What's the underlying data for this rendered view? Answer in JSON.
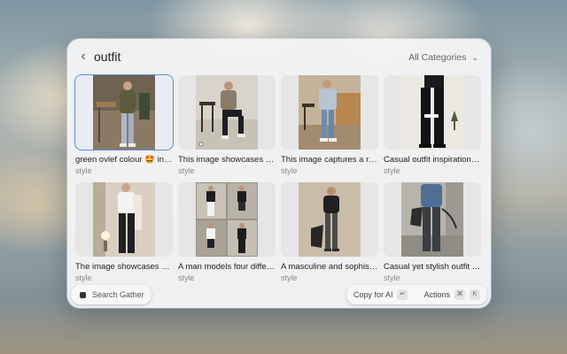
{
  "search": {
    "query": "outfit",
    "category": "All Categories"
  },
  "icons": {
    "back": "chevron-left-icon",
    "category": "chevron-down-icon",
    "gather": "gather-logo-icon"
  },
  "results": [
    {
      "title": "green ovlef colour 🤩 in 2...",
      "tag": "style",
      "selected": true
    },
    {
      "title": "This image showcases a r...",
      "tag": "style",
      "selected": false
    },
    {
      "title": "This image captures a rel...",
      "tag": "style",
      "selected": false
    },
    {
      "title": "Casual outfit inspiration w...",
      "tag": "style",
      "selected": false
    },
    {
      "title": "The image showcases a c...",
      "tag": "style",
      "selected": false
    },
    {
      "title": "A man models four differe...",
      "tag": "style",
      "selected": false
    },
    {
      "title": "A masculine and sophisti...",
      "tag": "style",
      "selected": false
    },
    {
      "title": "Casual yet stylish outfit in...",
      "tag": "style",
      "selected": false
    }
  ],
  "footer": {
    "gather_label": "Search Gather",
    "copy_label": "Copy for AI",
    "copy_key": "↵",
    "actions_label": "Actions",
    "actions_key1": "⌘",
    "actions_key2": "K"
  },
  "colors": {
    "selection": "#5b8fe3",
    "panel": "#f3f3f4"
  }
}
